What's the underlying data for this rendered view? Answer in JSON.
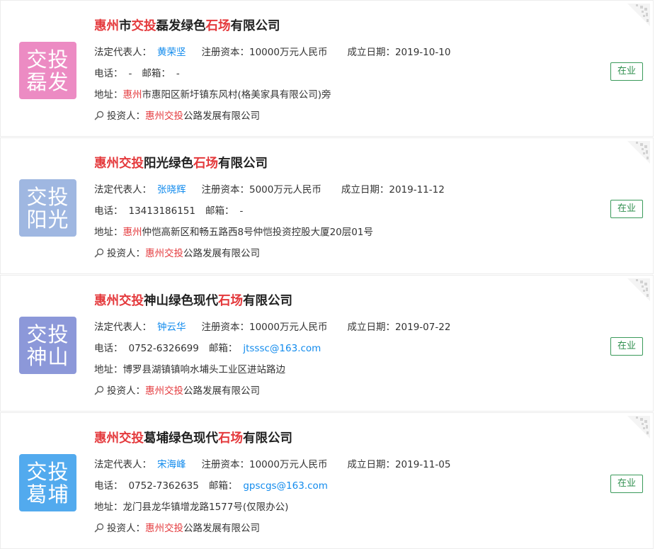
{
  "colors": {
    "highlight": "#e4393c",
    "link": "#128bed",
    "status_green": "#2f8f4e"
  },
  "labels": {
    "legal_rep": "法定代表人：",
    "capital": "注册资本：",
    "founded": "成立日期：",
    "phone": "电话：",
    "email": "邮箱：",
    "address": "地址：",
    "investor": "投资人："
  },
  "companies": [
    {
      "logo_text": [
        "交投",
        "磊发"
      ],
      "logo_color": "#ec8bc3",
      "title_parts": [
        {
          "t": "惠州",
          "hl": true
        },
        {
          "t": "市",
          "hl": false
        },
        {
          "t": "交投",
          "hl": true
        },
        {
          "t": "磊发绿色",
          "hl": false
        },
        {
          "t": "石场",
          "hl": true
        },
        {
          "t": "有限公司",
          "hl": false
        }
      ],
      "legal_rep": "黄荣坚",
      "capital": "10000万元人民币",
      "founded": "2019-10-10",
      "phone": "-",
      "email": "-",
      "email_is_link": false,
      "address_parts": [
        {
          "t": "惠州",
          "hl": true
        },
        {
          "t": "市惠阳区新圩镇东风村(格美家具有限公司)旁",
          "hl": false
        }
      ],
      "investor_parts": [
        {
          "t": "惠州交投",
          "hl": true
        },
        {
          "t": "公路发展有限公司",
          "hl": false
        }
      ],
      "status": "在业"
    },
    {
      "logo_text": [
        "交投",
        "阳光"
      ],
      "logo_color": "#9fb7e1",
      "title_parts": [
        {
          "t": "惠州交投",
          "hl": true
        },
        {
          "t": "阳光绿色",
          "hl": false
        },
        {
          "t": "石场",
          "hl": true
        },
        {
          "t": "有限公司",
          "hl": false
        }
      ],
      "legal_rep": "张晓辉",
      "capital": "5000万元人民币",
      "founded": "2019-11-12",
      "phone": "13413186151",
      "email": "-",
      "email_is_link": false,
      "address_parts": [
        {
          "t": "惠州",
          "hl": true
        },
        {
          "t": "仲恺高新区和畅五路西8号仲恺投资控股大厦20层01号",
          "hl": false
        }
      ],
      "investor_parts": [
        {
          "t": "惠州交投",
          "hl": true
        },
        {
          "t": "公路发展有限公司",
          "hl": false
        }
      ],
      "status": "在业"
    },
    {
      "logo_text": [
        "交投",
        "神山"
      ],
      "logo_color": "#8c98d9",
      "title_parts": [
        {
          "t": "惠州交投",
          "hl": true
        },
        {
          "t": "神山绿色现代",
          "hl": false
        },
        {
          "t": "石场",
          "hl": true
        },
        {
          "t": "有限公司",
          "hl": false
        }
      ],
      "legal_rep": "钟云华",
      "capital": "10000万元人民币",
      "founded": "2019-07-22",
      "phone": "0752-6326699",
      "email": "jtsssc@163.com",
      "email_is_link": true,
      "address_parts": [
        {
          "t": "博罗县湖镇镇响水埔头工业区进站路边",
          "hl": false
        }
      ],
      "investor_parts": [
        {
          "t": "惠州交投",
          "hl": true
        },
        {
          "t": "公路发展有限公司",
          "hl": false
        }
      ],
      "status": "在业"
    },
    {
      "logo_text": [
        "交投",
        "葛埔"
      ],
      "logo_color": "#52aaee",
      "title_parts": [
        {
          "t": "惠州交投",
          "hl": true
        },
        {
          "t": "葛埔绿色现代",
          "hl": false
        },
        {
          "t": "石场",
          "hl": true
        },
        {
          "t": "有限公司",
          "hl": false
        }
      ],
      "legal_rep": "宋海峰",
      "capital": "10000万元人民币",
      "founded": "2019-11-05",
      "phone": "0752-7362635",
      "email": "gpscgs@163.com",
      "email_is_link": true,
      "address_parts": [
        {
          "t": "龙门县龙华镇增龙路1577号(仅限办公)",
          "hl": false
        }
      ],
      "investor_parts": [
        {
          "t": "惠州交投",
          "hl": true
        },
        {
          "t": "公路发展有限公司",
          "hl": false
        }
      ],
      "status": "在业"
    }
  ]
}
